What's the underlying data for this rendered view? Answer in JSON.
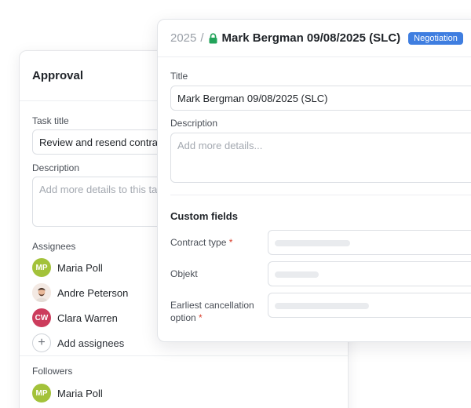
{
  "approval": {
    "title": "Approval",
    "task_title_label": "Task title",
    "task_title_value": "Review and resend contract",
    "description_label": "Description",
    "description_placeholder": "Add more details to this task",
    "assignees_label": "Assignees",
    "assignees": [
      {
        "initials": "MP",
        "name": "Maria Poll",
        "color": "#a3c23a"
      },
      {
        "initials": "",
        "name": "Andre Peterson",
        "avatar": "photo"
      },
      {
        "initials": "CW",
        "name": "Clara Warren",
        "color": "#cc3c5c"
      }
    ],
    "add_assignees_label": "Add assignees",
    "followers_label": "Followers",
    "followers": [
      {
        "initials": "MP",
        "name": "Maria Poll",
        "color": "#a3c23a"
      }
    ]
  },
  "deal": {
    "breadcrumb_year": "2025",
    "breadcrumb_separator": "/",
    "lock_icon": "lock-icon",
    "title": "Mark Bergman 09/08/2025 (SLC)",
    "stage_badge": "Negotiation",
    "title_label": "Title",
    "title_value": "Mark Bergman 09/08/2025 (SLC)",
    "description_label": "Description",
    "description_placeholder": "Add more details...",
    "custom_fields_title": "Custom fields",
    "custom_fields": [
      {
        "label": "Contract type",
        "required": true
      },
      {
        "label": "Objekt",
        "required": false
      },
      {
        "label": "Earliest cancellation option",
        "required": true
      }
    ]
  },
  "colors": {
    "accent": "#3f7ee0",
    "lock": "#22a35a",
    "required": "#d9402e"
  }
}
